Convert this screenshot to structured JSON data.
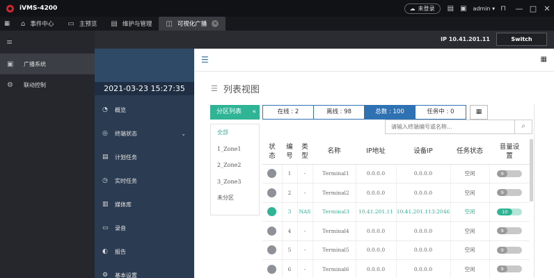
{
  "titlebar": {
    "app_title": "iVMS-4200",
    "login_status": "未登录",
    "username": "admin"
  },
  "menubar": {
    "items": [
      {
        "label": "事件中心",
        "icon": "event-icon"
      },
      {
        "label": "主预览",
        "icon": "preview-icon"
      },
      {
        "label": "维护与管理",
        "icon": "maintenance-icon"
      },
      {
        "label": "可视化广播",
        "icon": "broadcast-icon",
        "active": true
      }
    ]
  },
  "leftnav": {
    "items": [
      {
        "label": "广播系统",
        "icon": "broadcast-system-icon",
        "active": true
      },
      {
        "label": "联动控制",
        "icon": "linkage-icon"
      }
    ]
  },
  "header": {
    "ip": "IP  10.41.201.11",
    "switch_label": "Switch"
  },
  "broadcast_sidebar": {
    "datetime": "2021-03-23 15:27:35",
    "items": [
      {
        "label": "概览",
        "icon": "overview-icon"
      },
      {
        "label": "终端状态",
        "icon": "terminal-status-icon",
        "has_chevron": true
      },
      {
        "label": "计划任务",
        "icon": "schedule-icon"
      },
      {
        "label": "实时任务",
        "icon": "realtime-icon"
      },
      {
        "label": "媒体库",
        "icon": "media-library-icon"
      },
      {
        "label": "录音",
        "icon": "recording-icon"
      },
      {
        "label": "报告",
        "icon": "report-icon"
      },
      {
        "label": "基本设置",
        "icon": "settings-icon"
      }
    ]
  },
  "main": {
    "view_title": "列表视图",
    "zone_button": "分区列表",
    "zone_arrow": "«",
    "tabs": [
      "在线 : 2",
      "离线 : 98",
      "总数 : 100",
      "任务中 : 0"
    ],
    "active_tab": 2,
    "search_placeholder": "请输入终端编号或名称...",
    "zones": [
      "全部",
      "1_Zone1",
      "2_Zone2",
      "3_Zone3",
      "未分区"
    ],
    "table": {
      "headers": [
        "状\n态",
        "编\n号",
        "类\n型",
        "名称",
        "IP地址",
        "设备IP",
        "任务状态",
        "音量设\n置"
      ],
      "rows": [
        {
          "no": "1",
          "type": "-",
          "name": "Terminal1",
          "ip": "0.0.0.0",
          "device_ip": "0.0.0.0",
          "task": "空闲",
          "volume": "9",
          "online": false
        },
        {
          "no": "2",
          "type": "-",
          "name": "Terminal2",
          "ip": "0.0.0.0",
          "device_ip": "0.0.0.0",
          "task": "空闲",
          "volume": "9",
          "online": false
        },
        {
          "no": "3",
          "type": "NAS",
          "name": "Terminal3",
          "ip": "10.41.201.11",
          "device_ip": "10.41.201.113:2046",
          "task": "空闲",
          "volume": "10",
          "online": true
        },
        {
          "no": "4",
          "type": "-",
          "name": "Terminal4",
          "ip": "0.0.0.0",
          "device_ip": "0.0.0.0",
          "task": "空闲",
          "volume": "9",
          "online": false
        },
        {
          "no": "5",
          "type": "-",
          "name": "Terminal5",
          "ip": "0.0.0.0",
          "device_ip": "0.0.0.0",
          "task": "空闲",
          "volume": "9",
          "online": false
        },
        {
          "no": "6",
          "type": "-",
          "name": "Terminal6",
          "ip": "0.0.0.0",
          "device_ip": "0.0.0.0",
          "task": "空闲",
          "volume": "9",
          "online": false
        }
      ]
    }
  },
  "colors": {
    "accent_green": "#2fb495",
    "accent_blue": "#2f72b4",
    "sidebar_navy": "#2b3b52"
  }
}
